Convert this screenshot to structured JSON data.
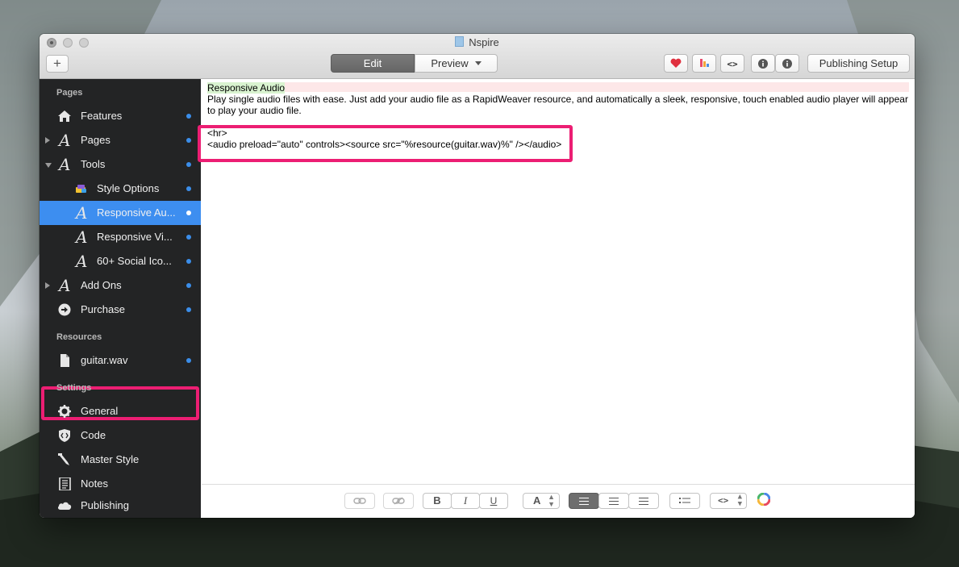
{
  "window": {
    "title": "Nspire"
  },
  "toolbar": {
    "add_label": "+",
    "edit_label": "Edit",
    "preview_label": "Preview",
    "publishing_setup_label": "Publishing Setup",
    "icons": [
      "heart-icon",
      "palette-icon",
      "code-icon",
      "info-icon",
      "info-alt-icon"
    ]
  },
  "sidebar": {
    "pages_header": "Pages",
    "resources_header": "Resources",
    "settings_header": "Settings",
    "pages": [
      {
        "label": "Features",
        "icon": "house-icon"
      },
      {
        "label": "Pages",
        "icon": "styled-text-icon"
      },
      {
        "label": "Tools",
        "icon": "styled-text-icon"
      },
      {
        "label": "Style Options",
        "icon": "paint-brush-icon"
      },
      {
        "label": "Responsive Au...",
        "icon": "styled-text-icon"
      },
      {
        "label": "Responsive Vi...",
        "icon": "styled-text-icon"
      },
      {
        "label": "60+ Social Ico...",
        "icon": "styled-text-icon"
      },
      {
        "label": "Add Ons",
        "icon": "styled-text-icon"
      },
      {
        "label": "Purchase",
        "icon": "arrow-circle-icon"
      }
    ],
    "resources": [
      {
        "label": "guitar.wav",
        "icon": "file-icon"
      }
    ],
    "settings": [
      {
        "label": "General",
        "icon": "gear-icon"
      },
      {
        "label": "Code",
        "icon": "code-shield-icon"
      },
      {
        "label": "Master Style",
        "icon": "eyedropper-icon"
      },
      {
        "label": "Notes",
        "icon": "notes-icon"
      },
      {
        "label": "Publishing",
        "icon": "cloud-icon"
      }
    ]
  },
  "editor": {
    "block_title": "Responsive Audio",
    "description": "Play single audio files with ease. Just add your audio file as a RapidWeaver resource, and automatically a sleek, responsive, touch enabled audio player will appear to play your audio file.",
    "hr_code": "<hr>",
    "audio_code": "<audio preload=\"auto\" controls><source src=\"%resource(guitar.wav)%\" /></audio>"
  },
  "format_bar": {
    "bold": "B",
    "italic": "I",
    "underline": "U",
    "font": "A",
    "code": "<>"
  },
  "colors": {
    "highlight": "#ec1e73",
    "selection": "#3d8ef0",
    "sidebar_bg": "#232425"
  }
}
